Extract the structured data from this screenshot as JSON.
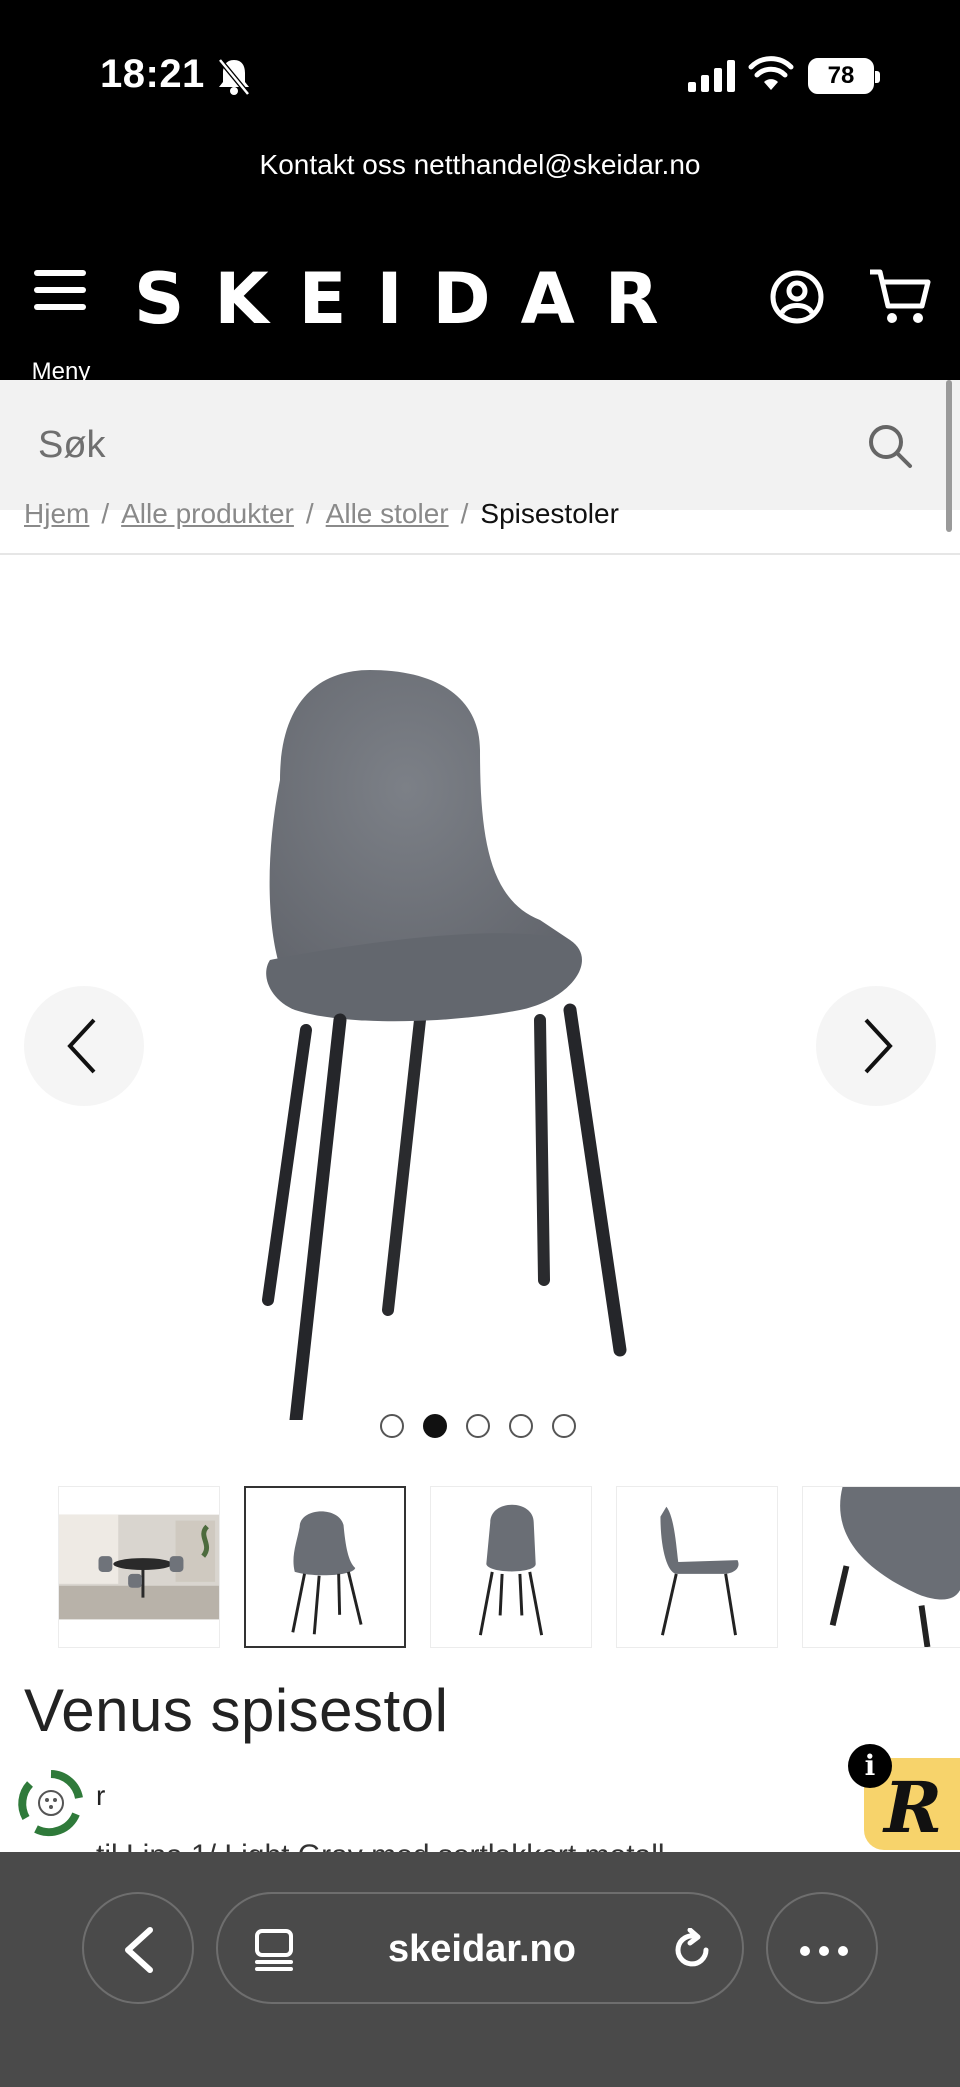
{
  "status_bar": {
    "time": "18:21",
    "battery": "78",
    "icons": [
      "bell-off-icon",
      "signal-icon",
      "wifi-icon",
      "battery-icon"
    ]
  },
  "contact_bar": {
    "text": "Kontakt oss netthandel@skeidar.no"
  },
  "header": {
    "menu_label": "Meny",
    "logo": "SKEIDAR",
    "icons": [
      "menu-icon",
      "account-icon",
      "cart-icon"
    ]
  },
  "search": {
    "placeholder": "Søk"
  },
  "breadcrumb": {
    "items": [
      "Hjem",
      "Alle produkter",
      "Alle stoler"
    ],
    "current": "Spisestoler",
    "separator": "/"
  },
  "gallery": {
    "dot_count": 5,
    "active_dot": 2,
    "thumbnail_count": 5,
    "selected_thumbnail": 2
  },
  "product": {
    "title": "Venus spisestol",
    "partial_line": "r",
    "description_partial": "til Lina 1/ Light Gray med sortlakkert metall"
  },
  "badges": {
    "reviews_letter": "R",
    "info": "i"
  },
  "browser": {
    "url": "skeidar.no"
  },
  "colors": {
    "header_bg": "#000000",
    "search_bg": "#f2f2f2",
    "chair_fabric": "#70747a",
    "reviews_badge": "#f7d36b",
    "browser_bg": "#4a4a4a"
  }
}
